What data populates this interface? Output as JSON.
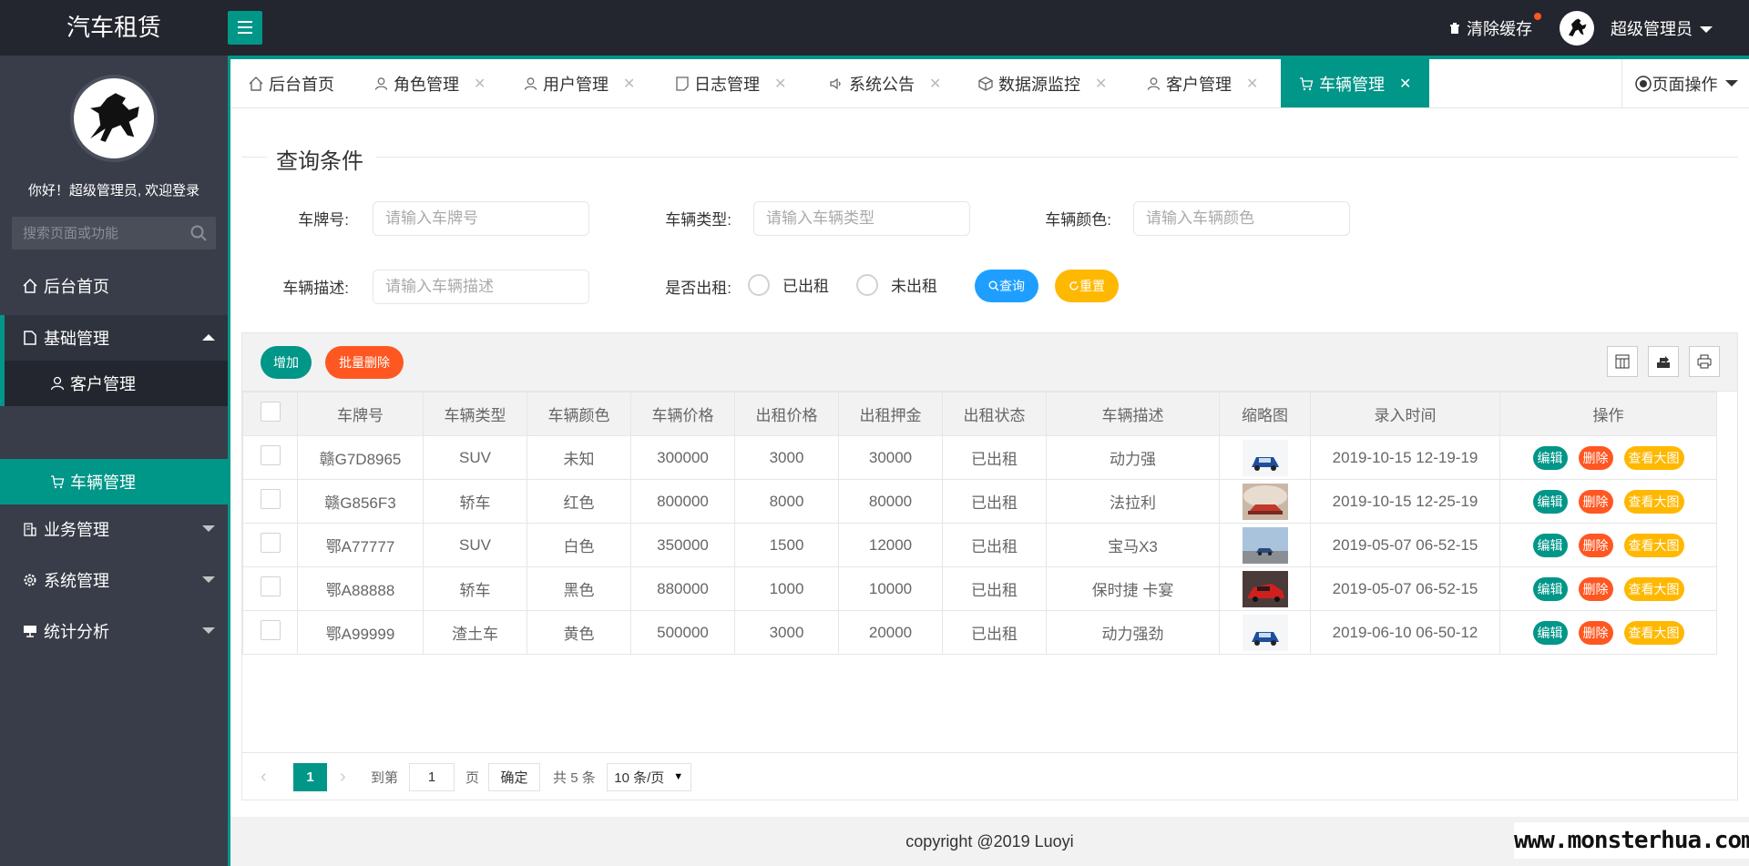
{
  "app": {
    "title": "汽车租赁"
  },
  "header": {
    "clear_cache": "清除缓存",
    "user": "超级管理员"
  },
  "sidebar": {
    "welcome": "你好！超级管理员, 欢迎登录",
    "search_placeholder": "搜索页面或功能",
    "items": [
      {
        "label": "后台首页"
      },
      {
        "label": "基础管理"
      },
      {
        "label": "客户管理"
      },
      {
        "label": "车辆管理"
      },
      {
        "label": "业务管理"
      },
      {
        "label": "系统管理"
      },
      {
        "label": "统计分析"
      }
    ]
  },
  "tabs": [
    {
      "label": "后台首页"
    },
    {
      "label": "角色管理"
    },
    {
      "label": "用户管理"
    },
    {
      "label": "日志管理"
    },
    {
      "label": "系统公告"
    },
    {
      "label": "数据源监控"
    },
    {
      "label": "客户管理"
    },
    {
      "label": "车辆管理"
    }
  ],
  "tab_close": "✕",
  "page_ops": "页面操作",
  "query": {
    "legend": "查询条件",
    "plate_label": "车牌号:",
    "plate_placeholder": "请输入车牌号",
    "type_label": "车辆类型:",
    "type_placeholder": "请输入车辆类型",
    "color_label": "车辆颜色:",
    "color_placeholder": "请输入车辆颜色",
    "desc_label": "车辆描述:",
    "desc_placeholder": "请输入车辆描述",
    "rented_label": "是否出租:",
    "opt_rented": "已出租",
    "opt_not_rented": "未出租",
    "search_btn": "查询",
    "reset_btn": "重置"
  },
  "toolbar": {
    "add": "增加",
    "batch_delete": "批量删除"
  },
  "table": {
    "headers": [
      "车牌号",
      "车辆类型",
      "车辆颜色",
      "车辆价格",
      "出租价格",
      "出租押金",
      "出租状态",
      "车辆描述",
      "缩略图",
      "录入时间",
      "操作"
    ],
    "rows": [
      {
        "plate": "赣G7D8965",
        "type": "SUV",
        "color": "未知",
        "price": "300000",
        "rent": "3000",
        "deposit": "30000",
        "status": "已出租",
        "desc": "动力强",
        "thumb": "blue-car",
        "time": "2019-10-15 12-19-19"
      },
      {
        "plate": "赣G856F3",
        "type": "轿车",
        "color": "红色",
        "price": "800000",
        "rent": "8000",
        "deposit": "80000",
        "status": "已出租",
        "desc": "法拉利",
        "thumb": "red-car-smoke",
        "time": "2019-10-15 12-25-19"
      },
      {
        "plate": "鄂A77777",
        "type": "SUV",
        "color": "白色",
        "price": "350000",
        "rent": "1500",
        "deposit": "12000",
        "status": "已出租",
        "desc": "宝马X3",
        "thumb": "car-sky",
        "time": "2019-05-07 06-52-15"
      },
      {
        "plate": "鄂A88888",
        "type": "轿车",
        "color": "黑色",
        "price": "880000",
        "rent": "1000",
        "deposit": "10000",
        "status": "已出租",
        "desc": "保时捷 卡宴",
        "thumb": "red-sports-car",
        "time": "2019-05-07 06-52-15"
      },
      {
        "plate": "鄂A99999",
        "type": "渣土车",
        "color": "黄色",
        "price": "500000",
        "rent": "3000",
        "deposit": "20000",
        "status": "已出租",
        "desc": "动力强劲",
        "thumb": "blue-car",
        "time": "2019-06-10 06-50-12"
      }
    ],
    "actions": {
      "edit": "编辑",
      "delete": "删除",
      "view": "查看大图"
    }
  },
  "pager": {
    "current": "1",
    "goto": "到第",
    "goto_value": "1",
    "page_word": "页",
    "confirm": "确定",
    "total": "共 5 条",
    "page_size": "10 条/页"
  },
  "footer": {
    "copyright": "copyright @2019 Luoyi"
  },
  "watermark": "www.monsterhua.com",
  "colors": {
    "teal": "#009688",
    "blue": "#1e9fff",
    "orange": "#ff5722",
    "yellow": "#ffb800",
    "dark": "#23262e",
    "sidebar": "#393d49"
  }
}
